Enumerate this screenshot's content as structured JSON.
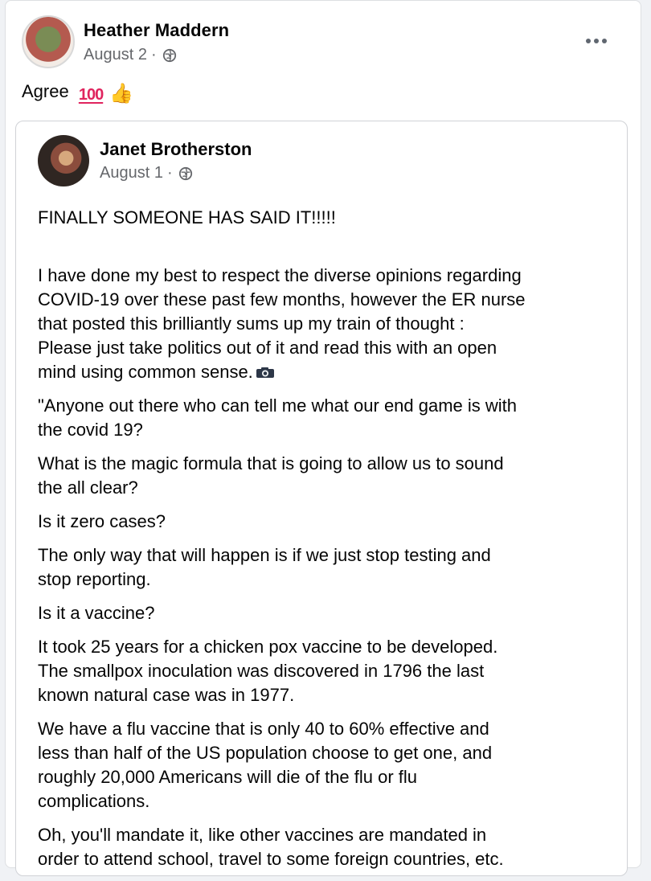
{
  "post": {
    "author": "Heather Maddern",
    "date": "August 2",
    "separator": "·",
    "text": "Agree",
    "emojis": {
      "hundred": "100",
      "thumbs_up": "👍"
    },
    "icons": {
      "privacy": "globe-icon",
      "menu": "more-options-icon"
    },
    "colors": {
      "name": "#050505",
      "meta": "#65676b",
      "border": "#d0d2d6"
    }
  },
  "shared_post": {
    "author": "Janet Brotherston",
    "date": "August 1",
    "separator": "·",
    "paragraphs": [
      "FINALLY SOMEONE HAS SAID IT!!!!!",
      "I have done my best to respect the diverse opinions regarding\nCOVID-19 over these past few months, however the ER nurse\nthat posted this brilliantly sums up my train of thought :\nPlease just take politics out of it and read this with an open\nmind using common sense.",
      "\"Anyone out there who can tell me what our end game is with\nthe covid 19?",
      "What is the magic formula that is going to allow us to sound\nthe all clear?",
      "Is it zero cases?",
      "The only way that will happen is if we just stop testing and\nstop reporting.",
      "Is it a vaccine?",
      "It took 25 years for a chicken pox vaccine to be developed.\nThe smallpox inoculation was discovered in 1796 the last\nknown natural case was in 1977.",
      "We have a flu vaccine that is only 40 to 60% effective and\nless than half of the US population choose to get one, and\nroughly 20,000 Americans will die of the flu or flu\ncomplications.",
      "Oh, you'll mandate it, like other vaccines are mandated in\norder to attend school, travel to some foreign countries, etc."
    ],
    "inline_icon": "camera-icon"
  }
}
